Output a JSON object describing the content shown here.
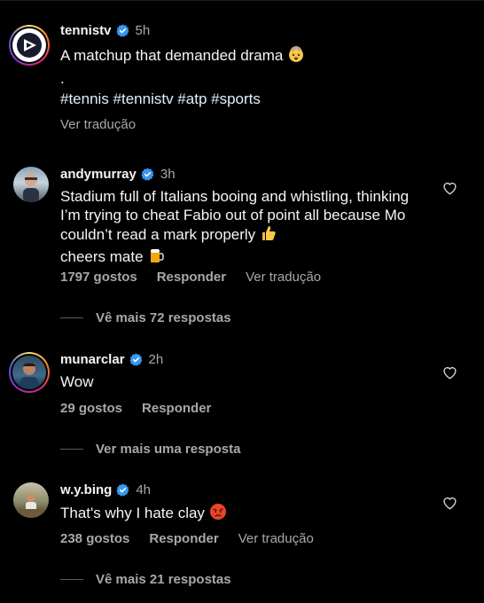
{
  "post": {
    "username": "tennistv",
    "time": "5h",
    "caption": "A matchup that demanded drama",
    "dot": ".",
    "hashtags": "#tennis #tennistv #atp #sports",
    "translate": "Ver tradução"
  },
  "comments": [
    {
      "username": "andymurray",
      "time": "3h",
      "text": "Stadium full of Italians booing and whistling, thinking I’m trying to cheat Fabio out of point all because Mo couldn’t read a mark properly",
      "text_tail": "cheers mate",
      "likes": "1797 gostos",
      "reply": "Responder",
      "translate": "Ver tradução",
      "more_replies": "Vê mais 72 respostas"
    },
    {
      "username": "munarclar",
      "time": "2h",
      "text": "Wow",
      "likes": "29 gostos",
      "reply": "Responder",
      "more_replies": "Ver mais uma resposta"
    },
    {
      "username": "w.y.bing",
      "time": "4h",
      "text": "That's why I hate clay",
      "likes": "238 gostos",
      "reply": "Responder",
      "translate": "Ver tradução",
      "more_replies": "Vê mais 21 respostas"
    }
  ],
  "colors": {
    "verified": "#3897f0",
    "secondary_text": "#a8a8a8",
    "background": "#000000"
  }
}
